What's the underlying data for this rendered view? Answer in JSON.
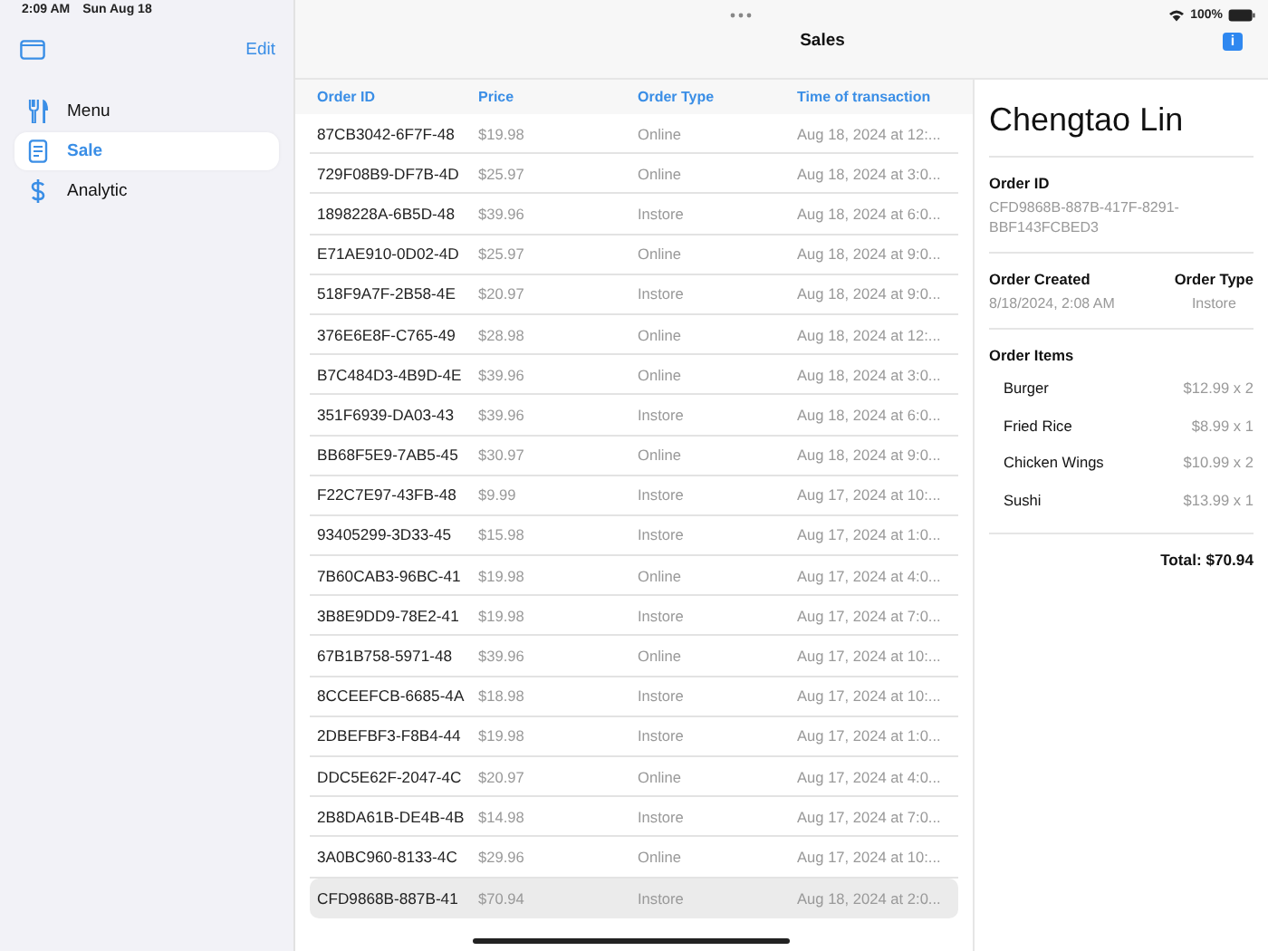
{
  "status_bar": {
    "time": "2:09 AM",
    "date": "Sun Aug 18",
    "battery": "100%"
  },
  "sidebar": {
    "edit": "Edit",
    "items": [
      {
        "label": "Menu",
        "kind": "menu",
        "selected": false
      },
      {
        "label": "Sale",
        "kind": "sale",
        "selected": true
      },
      {
        "label": "Analytic",
        "kind": "analytic",
        "selected": false
      }
    ]
  },
  "title": "Sales",
  "badge": "i",
  "table": {
    "columns": [
      "Order ID",
      "Price",
      "Order Type",
      "Time of transaction"
    ],
    "rows": [
      {
        "cells": [
          "87CB3042-6F7F-48",
          "$19.98",
          "Online",
          "Aug 18, 2024 at 12:..."
        ],
        "selected": false
      },
      {
        "cells": [
          "729F08B9-DF7B-4D",
          "$25.97",
          "Online",
          "Aug 18, 2024 at 3:0..."
        ],
        "selected": false
      },
      {
        "cells": [
          "1898228A-6B5D-48",
          "$39.96",
          "Instore",
          "Aug 18, 2024 at 6:0..."
        ],
        "selected": false
      },
      {
        "cells": [
          "E71AE910-0D02-4D",
          "$25.97",
          "Online",
          "Aug 18, 2024 at 9:0..."
        ],
        "selected": false
      },
      {
        "cells": [
          "518F9A7F-2B58-4E",
          "$20.97",
          "Instore",
          "Aug 18, 2024 at 9:0..."
        ],
        "selected": false
      },
      {
        "cells": [
          "376E6E8F-C765-49",
          "$28.98",
          "Online",
          "Aug 18, 2024 at 12:..."
        ],
        "selected": false
      },
      {
        "cells": [
          "B7C484D3-4B9D-4E",
          "$39.96",
          "Online",
          "Aug 18, 2024 at 3:0..."
        ],
        "selected": false
      },
      {
        "cells": [
          "351F6939-DA03-43",
          "$39.96",
          "Instore",
          "Aug 18, 2024 at 6:0..."
        ],
        "selected": false
      },
      {
        "cells": [
          "BB68F5E9-7AB5-45",
          "$30.97",
          "Online",
          "Aug 18, 2024 at 9:0..."
        ],
        "selected": false
      },
      {
        "cells": [
          "F22C7E97-43FB-48",
          "$9.99",
          "Instore",
          "Aug 17, 2024 at 10:..."
        ],
        "selected": false
      },
      {
        "cells": [
          "93405299-3D33-45",
          "$15.98",
          "Instore",
          "Aug 17, 2024 at 1:0..."
        ],
        "selected": false
      },
      {
        "cells": [
          "7B60CAB3-96BC-41",
          "$19.98",
          "Online",
          "Aug 17, 2024 at 4:0..."
        ],
        "selected": false
      },
      {
        "cells": [
          "3B8E9DD9-78E2-41",
          "$19.98",
          "Instore",
          "Aug 17, 2024 at 7:0..."
        ],
        "selected": false
      },
      {
        "cells": [
          "67B1B758-5971-48",
          "$39.96",
          "Online",
          "Aug 17, 2024 at 10:..."
        ],
        "selected": false
      },
      {
        "cells": [
          "8CCEEFCB-6685-4A",
          "$18.98",
          "Instore",
          "Aug 17, 2024 at 10:..."
        ],
        "selected": false
      },
      {
        "cells": [
          "2DBEFBF3-F8B4-44",
          "$19.98",
          "Instore",
          "Aug 17, 2024 at 1:0..."
        ],
        "selected": false
      },
      {
        "cells": [
          "DDC5E62F-2047-4C",
          "$20.97",
          "Online",
          "Aug 17, 2024 at 4:0..."
        ],
        "selected": false
      },
      {
        "cells": [
          "2B8DA61B-DE4B-4B",
          "$14.98",
          "Instore",
          "Aug 17, 2024 at 7:0..."
        ],
        "selected": false
      },
      {
        "cells": [
          "3A0BC960-8133-4C",
          "$29.96",
          "Online",
          "Aug 17, 2024 at 10:..."
        ],
        "selected": false
      },
      {
        "cells": [
          "CFD9868B-887B-41",
          "$70.94",
          "Instore",
          "Aug 18, 2024 at 2:0..."
        ],
        "selected": true
      }
    ]
  },
  "detail": {
    "name": "Chengtao Lin",
    "order_id_label": "Order ID",
    "order_id": "CFD9868B-887B-417F-8291-BBF143FCBED3",
    "created_label": "Order Created",
    "created": "8/18/2024, 2:08 AM",
    "type_label": "Order Type",
    "type": "Instore",
    "items_label": "Order Items",
    "items": [
      {
        "name": "Burger",
        "price": "$12.99 x 2"
      },
      {
        "name": "Fried Rice",
        "price": "$8.99 x 1"
      },
      {
        "name": "Chicken Wings",
        "price": "$10.99 x 2"
      },
      {
        "name": "Sushi",
        "price": "$13.99 x 1"
      }
    ],
    "total": "Total: $70.94"
  }
}
